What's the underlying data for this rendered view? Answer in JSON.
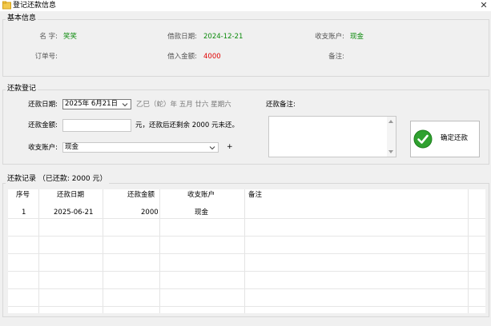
{
  "window": {
    "title": "登记还款信息"
  },
  "basic_info": {
    "legend": "基本信息",
    "name_label": "名 字:",
    "name_value": "笑笑",
    "date_label": "借款日期:",
    "date_value": "2024-12-21",
    "account_label": "收支账户:",
    "account_value": "现金",
    "order_label": "订单号:",
    "order_value": "",
    "amount_label": "借入金额:",
    "amount_value": "4000",
    "note_label": "备注:",
    "note_value": ""
  },
  "repayment": {
    "legend": "还款登记",
    "date_label": "还款日期:",
    "date_value": "2025年 6月21日",
    "lunar": "乙巳（蛇）年 五月 廿六 星期六",
    "note_label": "还款备注:",
    "amount_label": "还款金额:",
    "amount_value": "",
    "amount_hint": "元，还款后还剩余 2000 元未还。",
    "account_label": "收支账户:",
    "account_value": "现金",
    "add_label": "+",
    "confirm_label": "确定还款"
  },
  "records": {
    "legend": "还款记录 （已还款: 2000 元）",
    "columns": [
      "序号",
      "还款日期",
      "还款金额",
      "收支账户",
      "备注"
    ],
    "rows": [
      {
        "no": "1",
        "date": "2025-06-21",
        "amount": "2000",
        "account": "现金",
        "note": ""
      }
    ]
  },
  "colors": {
    "value_green": "#0a8a0a",
    "value_red": "#e00000",
    "check_green": "#2fa12f"
  },
  "icons": {
    "app": "folder-icon",
    "close": "close-icon",
    "dropdown": "chevron-down-icon",
    "confirm": "check-icon"
  }
}
